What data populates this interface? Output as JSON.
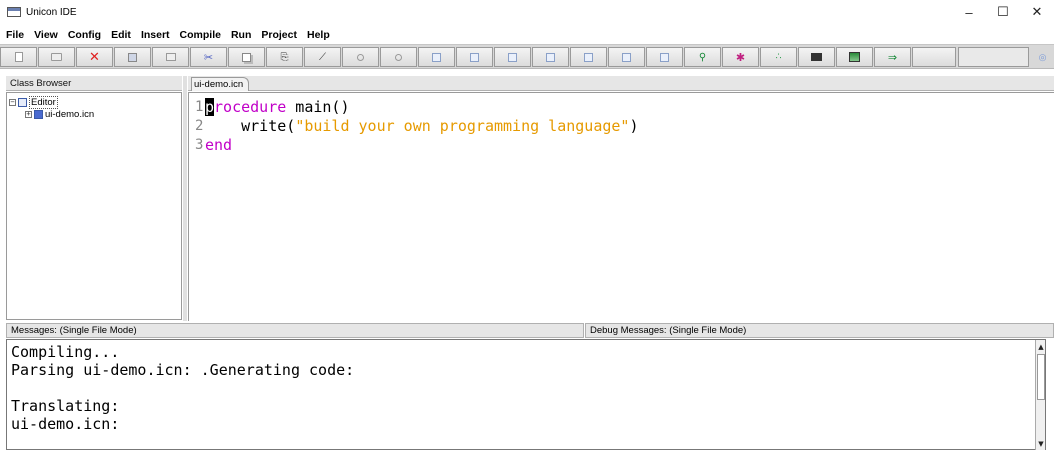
{
  "window": {
    "title": "Unicon IDE",
    "minimize": "–",
    "maximize": "☐",
    "close": "✕"
  },
  "menu": [
    "File",
    "View",
    "Config",
    "Edit",
    "Insert",
    "Compile",
    "Run",
    "Project",
    "Help"
  ],
  "toolbar": {
    "icons": [
      "new-file-icon",
      "open-folder-icon",
      "close-file-icon",
      "save-icon",
      "print-icon",
      "cut-icon",
      "copy-icon",
      "paste-icon",
      "undo-icon",
      "redo-icon",
      "window-icon",
      "window-icon",
      "window-icon",
      "window-icon",
      "tree-icon",
      "debug-icon",
      "sparkle-icon",
      "monitor-icon",
      "image-icon",
      "run-icon"
    ]
  },
  "class_browser": {
    "title": "Class Browser",
    "tree": {
      "root": "Editor",
      "child": "ui-demo.icn"
    }
  },
  "editor": {
    "tab": "ui-demo.icn",
    "lines": [
      {
        "no": "1",
        "kw": "procedure",
        "rest": " main()"
      },
      {
        "no": "2",
        "indent": "    ",
        "fn": "write(",
        "str": "\"build your own programming language\"",
        "end": ")"
      },
      {
        "no": "3",
        "kw": "end"
      }
    ]
  },
  "messages": {
    "title": "Messages: (Single File Mode)",
    "debug_title": "Debug Messages: (Single File Mode)",
    "lines": [
      "Compiling...",
      "Parsing ui-demo.icn: .Generating code:",
      "",
      "Translating:",
      "ui-demo.icn:"
    ]
  },
  "colors": {
    "keyword": "#c100c8",
    "string": "#e69a00",
    "toolbar_bg": "#d8d8d8"
  }
}
